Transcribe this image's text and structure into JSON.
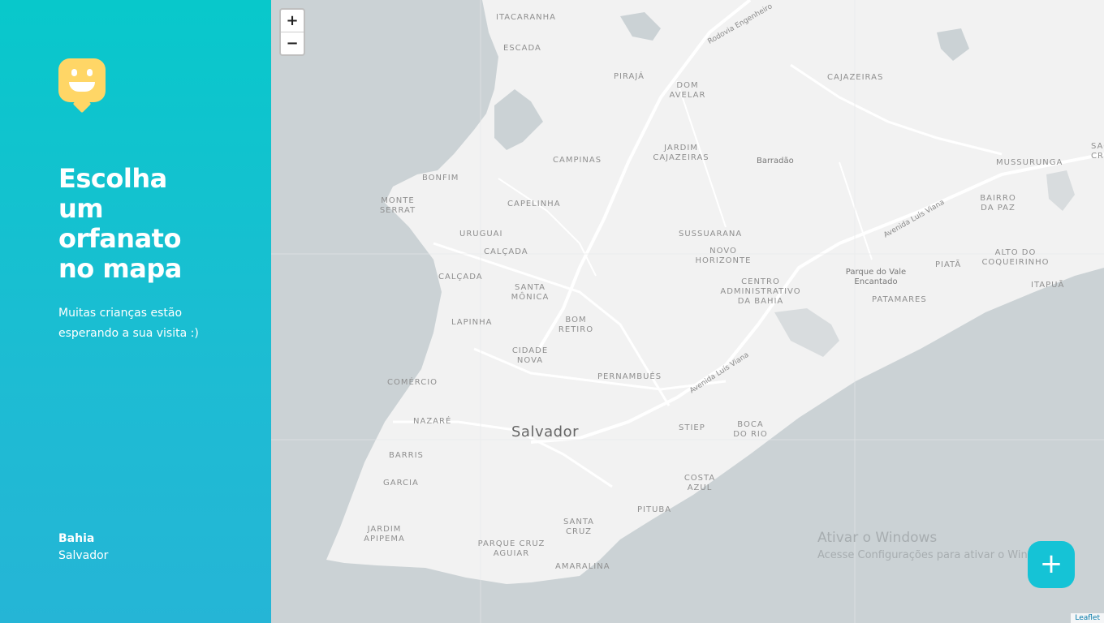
{
  "sidebar": {
    "title": "Escolha um orfanato no mapa",
    "subtitle": "Muitas crianças estão esperando a sua visita :)",
    "location": {
      "state": "Bahia",
      "city": "Salvador"
    },
    "icon": "happy-map-marker-icon"
  },
  "map": {
    "zoom_in": "+",
    "zoom_out": "−",
    "city_label": "Salvador",
    "neighborhoods": [
      "ITACARANHA",
      "ESCADA",
      "PIRAJÁ",
      "DOM AVELAR",
      "CAJAZEIRAS",
      "CAMPINAS",
      "JARDIM CAJAZEIRAS",
      "Barradão",
      "MUSSURUNGA",
      "BONFIM",
      "MONTE SERRAT",
      "CAPELINHA",
      "URUGUAI",
      "CALÇADA",
      "SUSSUARANA",
      "NOVO HORIZONTE",
      "BAIRRO DA PAZ",
      "CALÇADA",
      "SANTA MÔNICA",
      "CENTRO ADMINISTRATIVO DA BAHIA",
      "Parque do Vale Encantado",
      "PIATÃ",
      "ALTO DO COQUEIRINHO",
      "ITAPUÃ",
      "PATAMARES",
      "LAPINHA",
      "BOM RETIRO",
      "CIDADE NOVA",
      "COMÉRCIO",
      "PERNAMBUÉS",
      "NAZARÉ",
      "STIEP",
      "BOCA DO RIO",
      "BARRIS",
      "GARCIA",
      "COSTA AZUL",
      "PITUBA",
      "JARDIM APIPEMA",
      "SANTA CRUZ",
      "PARQUE CRUZ AGUIAR",
      "AMARALINA",
      "SÃO CRISTÓVÃO"
    ],
    "roads": [
      "Rodovia Engenheiro",
      "Avenida Luís Viana",
      "Avenida Luís Viana"
    ],
    "attribution": "Leaflet",
    "add_button": "+"
  },
  "watermark": {
    "title": "Ativar o Windows",
    "subtitle": "Acesse Configurações para ativar o Windows."
  },
  "colors": {
    "sidebar_top": "#08c8cb",
    "sidebar_bottom": "#25b5d6",
    "logo": "#ffd666",
    "water": "#cbd2d5",
    "land": "#f2f2f2",
    "fab": "#15c3d6"
  }
}
